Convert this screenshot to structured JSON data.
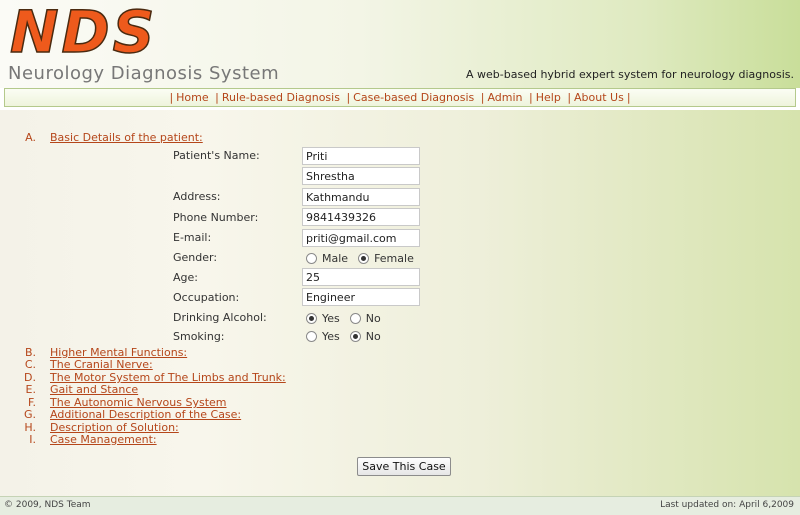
{
  "header": {
    "logo": "NDS",
    "system_name": "Neurology Diagnosis System",
    "tagline": "A web-based hybrid expert system for neurology diagnosis."
  },
  "nav": {
    "home": "Home",
    "rule_based": "Rule-based Diagnosis",
    "case_based": "Case-based Diagnosis",
    "admin": "Admin",
    "help": "Help",
    "about": "About Us"
  },
  "sections": {
    "a": {
      "letter": "A.",
      "label": "Basic Details of the patient:"
    },
    "b": {
      "letter": "B.",
      "label": "Higher Mental Functions:"
    },
    "c": {
      "letter": "C.",
      "label": "The Cranial Nerve:"
    },
    "d": {
      "letter": "D.",
      "label": "The Motor System of The Limbs and Trunk:"
    },
    "e": {
      "letter": "E.",
      "label": "Gait and Stance"
    },
    "f": {
      "letter": "F.",
      "label": "The Autonomic Nervous System"
    },
    "g": {
      "letter": "G.",
      "label": "Additional Description of the Case:"
    },
    "h": {
      "letter": "H.",
      "label": "Description of Solution:"
    },
    "i": {
      "letter": "I.",
      "label": "Case Management:"
    }
  },
  "form": {
    "name_label": "Patient's Name:",
    "first_name": "Priti",
    "last_name": "Shrestha",
    "address_label": "Address:",
    "address": "Kathmandu",
    "phone_label": "Phone Number:",
    "phone": "9841439326",
    "email_label": "E-mail:",
    "email": "priti@gmail.com",
    "gender_label": "Gender:",
    "gender_male": "Male",
    "gender_female": "Female",
    "gender_selected": "Female",
    "age_label": "Age:",
    "age": "25",
    "occupation_label": "Occupation:",
    "occupation": "Engineer",
    "drinking_label": "Drinking Alcohol:",
    "drinking_yes": "Yes",
    "drinking_no": "No",
    "drinking_selected": "Yes",
    "smoking_label": "Smoking:",
    "smoking_yes": "Yes",
    "smoking_no": "No",
    "smoking_selected": "No",
    "save_label": "Save This Case"
  },
  "footer": {
    "copyright": "© 2009, NDS Team",
    "updated": "Last updated on: April 6,2009"
  },
  "colors": {
    "accent": "#b5461a",
    "logo": "#ee5a1c"
  }
}
